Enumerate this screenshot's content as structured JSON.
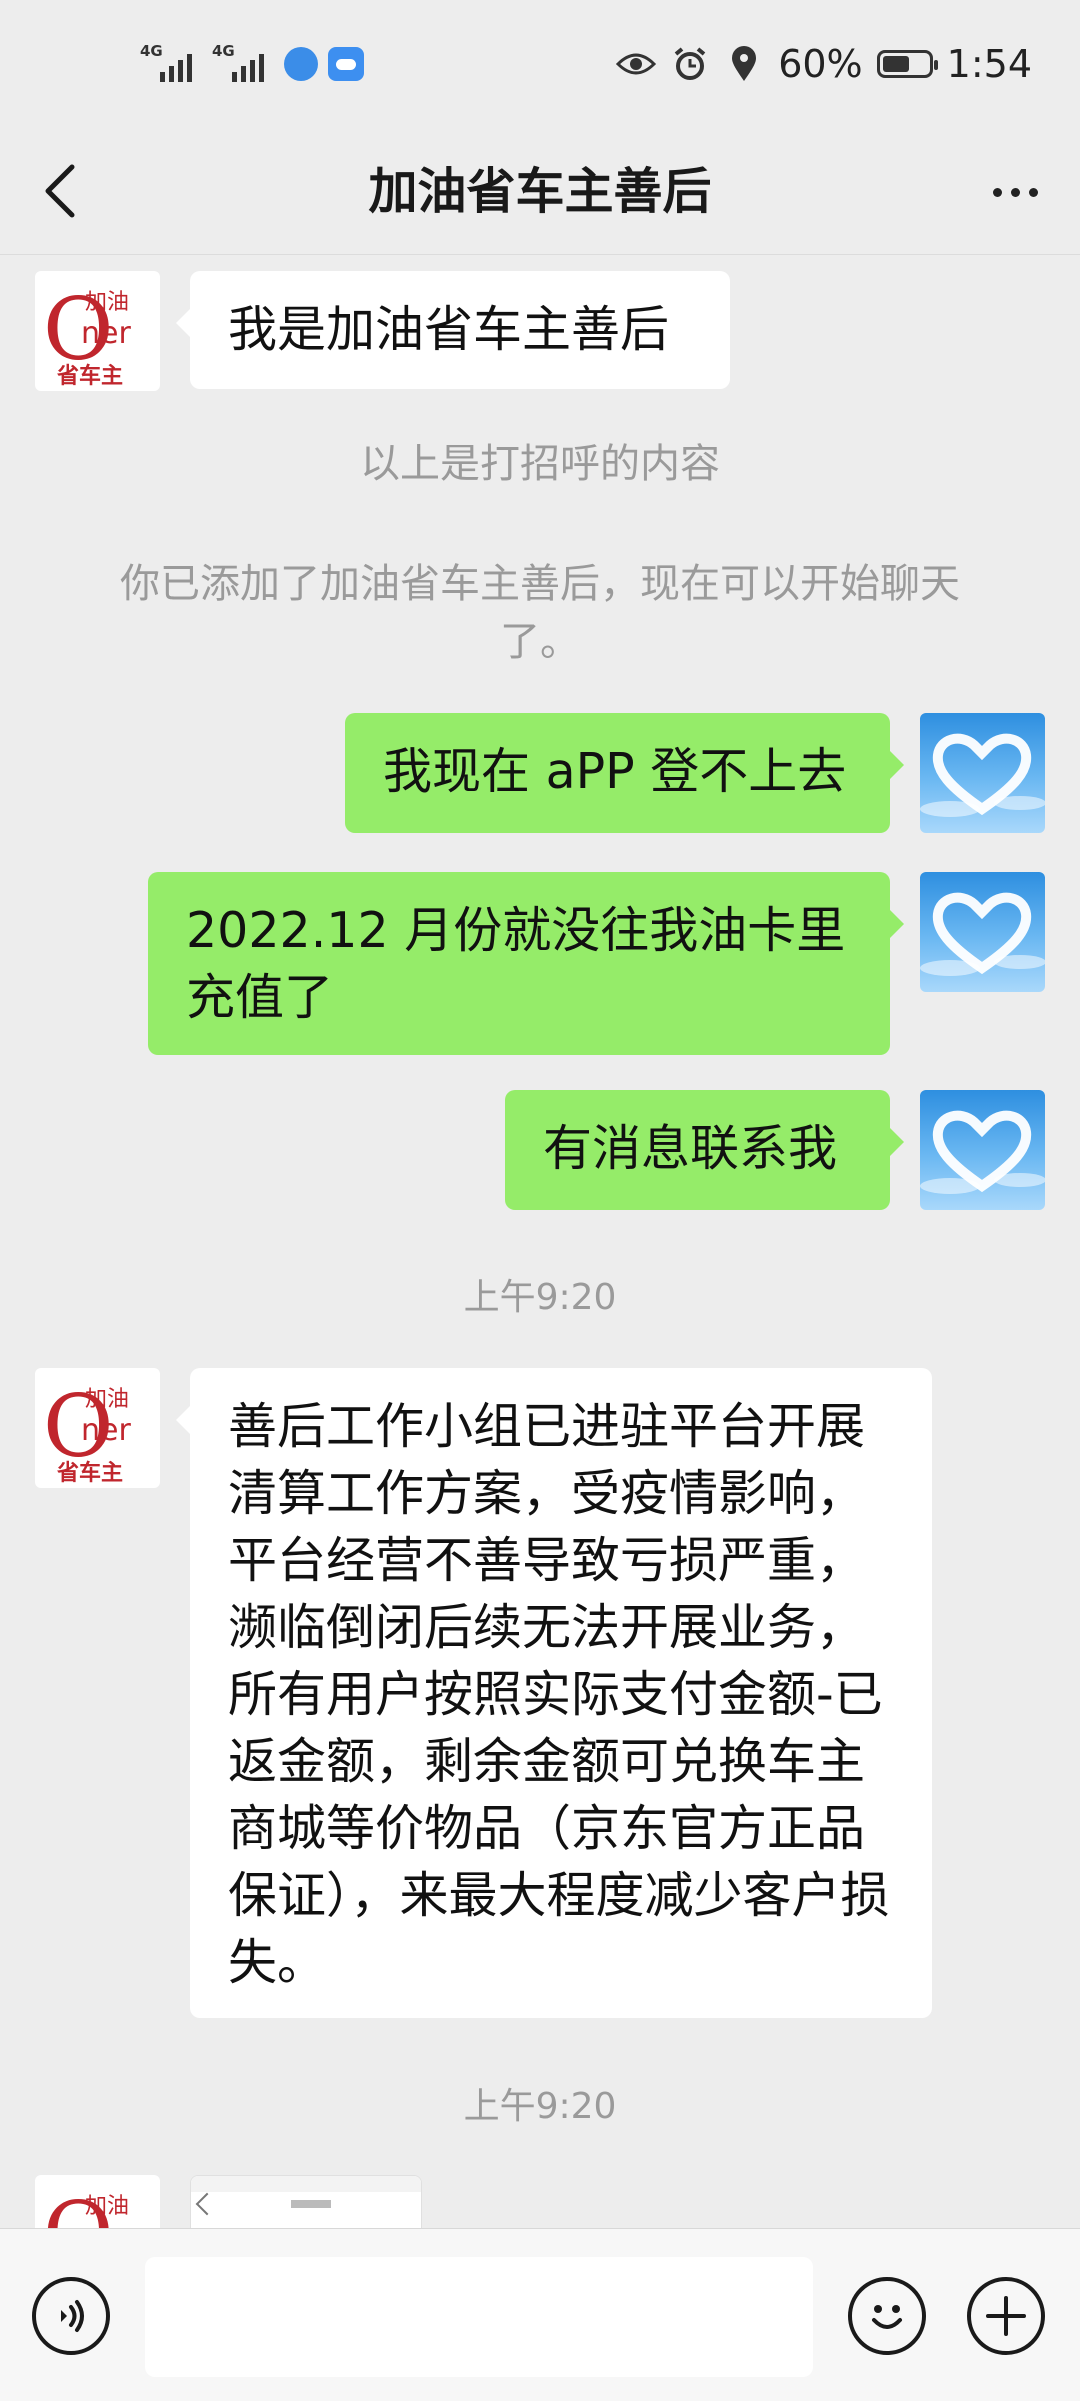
{
  "status_bar": {
    "net1": "4G",
    "net2": "4G",
    "battery": "60%",
    "battery_level": 0.6,
    "time": "1:54"
  },
  "header": {
    "title": "加油省车主善后",
    "back_icon": "chevron-left-icon",
    "more_icon": "more-dots-icon"
  },
  "chat": {
    "avatar_logo_text": "Owner 加油 省车主",
    "messages": [
      {
        "type": "in",
        "text": "我是加油省车主善后"
      },
      {
        "type": "system",
        "text": "以上是打招呼的内容"
      },
      {
        "type": "system",
        "text": "你已添加了加油省车主善后，现在可以开始聊天了。"
      },
      {
        "type": "out",
        "text": "我现在 aPP 登不上去"
      },
      {
        "type": "out",
        "text": "2022.12 月份就没往我油卡里充值了"
      },
      {
        "type": "out",
        "text": "有消息联系我"
      },
      {
        "type": "time",
        "text": "上午9:20"
      },
      {
        "type": "in",
        "text": "善后工作小组已进驻平台开展清算工作方案，受疫情影响，平台经营不善导致亏损严重，濒临倒闭后续无法开展业务，所有用户按照实际支付金额-已返金额，剩余金额可兑换车主商城等价物品（京东官方正品保证），来最大程度减少客户损失。"
      },
      {
        "type": "time",
        "text": "上午9:20"
      },
      {
        "type": "in_image",
        "text": ""
      }
    ]
  },
  "input_bar": {
    "voice_icon": "voice-icon",
    "placeholder": "",
    "emoji_icon": "emoji-icon",
    "plus_icon": "plus-icon"
  },
  "colors": {
    "background": "#ededed",
    "outgoing_bubble": "#95ec69",
    "incoming_bubble": "#ffffff",
    "system_text": "#9a9a9a"
  }
}
